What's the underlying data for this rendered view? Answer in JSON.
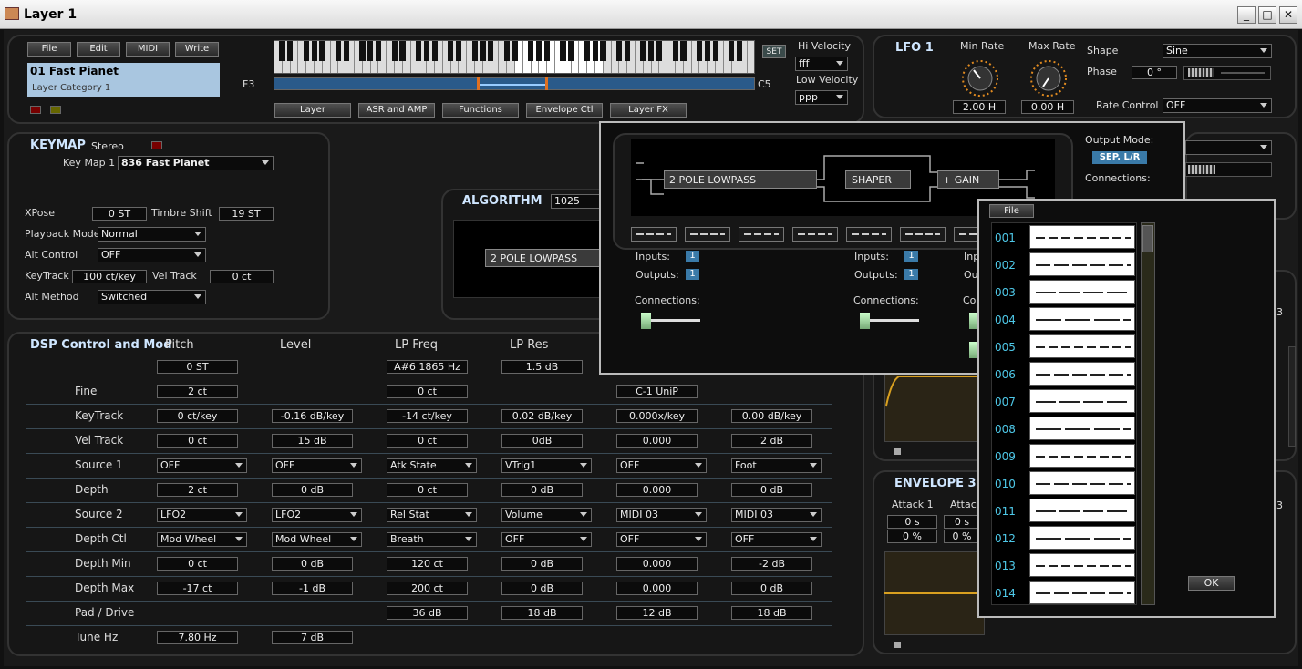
{
  "window": {
    "title": "Layer 1"
  },
  "top": {
    "menu": [
      "File",
      "Edit",
      "MIDI",
      "Write"
    ],
    "program": {
      "name": "01   Fast Pianet",
      "category": "Layer Category 1"
    },
    "keyboard": {
      "low": "F3",
      "high": "C5",
      "set": "SET"
    },
    "hi_velocity": {
      "label": "Hi Velocity",
      "value": "fff"
    },
    "low_velocity": {
      "label": "Low Velocity",
      "value": "ppp"
    },
    "tabs": [
      "Layer",
      "ASR and AMP",
      "Functions",
      "Envelope Ctl",
      "Layer FX"
    ]
  },
  "lfo": {
    "title": "LFO 1",
    "min_rate_label": "Min Rate",
    "min_rate": "2.00 H",
    "max_rate_label": "Max Rate",
    "max_rate": "0.00 H",
    "shape_label": "Shape",
    "shape": "Sine",
    "phase_label": "Phase",
    "phase": "0 °",
    "rate_control_label": "Rate Control",
    "rate_control": "OFF"
  },
  "keymap": {
    "title": "KEYMAP",
    "stereo_label": "Stereo",
    "keymap1_label": "Key Map 1",
    "keymap1": "836 Fast Pianet",
    "xpose_label": "XPose",
    "xpose": "0 ST",
    "timbre_label": "Timbre Shift",
    "timbre": "19 ST",
    "playback_label": "Playback Mode",
    "playback": "Normal",
    "altctl_label": "Alt Control",
    "altctl": "OFF",
    "keytrack_label": "KeyTrack",
    "keytrack": "100 ct/key",
    "veltrack_label": "Vel Track",
    "veltrack": "0 ct",
    "altmethod_label": "Alt Method",
    "altmethod": "Switched"
  },
  "algorithm": {
    "title": "ALGORITHM",
    "number": "1025",
    "block1": "2 POLE LOWPASS"
  },
  "dsp": {
    "title": "DSP Control and Mod",
    "columns": [
      "Pitch",
      "Level",
      "LP Freq",
      "LP Res"
    ],
    "top_values": [
      "0 ST",
      "",
      "A#6 1865 Hz",
      "1.5 dB"
    ],
    "rows": [
      {
        "label": "Fine",
        "cells": [
          "2 ct",
          "",
          "0 ct",
          "",
          "C-1 UniP",
          ""
        ]
      },
      {
        "label": "KeyTrack",
        "cells": [
          "0 ct/key",
          "-0.16 dB/key",
          "-14 ct/key",
          "0.02 dB/key",
          "0.000x/key",
          "0.00 dB/key"
        ]
      },
      {
        "label": "Vel Track",
        "cells": [
          "0 ct",
          "15 dB",
          "0 ct",
          "0dB",
          "0.000",
          "2 dB"
        ]
      },
      {
        "label": "Source 1",
        "cells": [
          "OFF",
          "OFF",
          "Atk State",
          "VTrig1",
          "OFF",
          "Foot"
        ],
        "dd": true
      },
      {
        "label": "Depth",
        "cells": [
          "2 ct",
          "0 dB",
          "0 ct",
          "0 dB",
          "0.000",
          "0 dB"
        ]
      },
      {
        "label": "Source 2",
        "cells": [
          "LFO2",
          "LFO2",
          "Rel Stat",
          "Volume",
          "MIDI 03",
          "MIDI 03"
        ],
        "dd": true
      },
      {
        "label": "Depth Ctl",
        "cells": [
          "Mod Wheel",
          "Mod Wheel",
          "Breath",
          "OFF",
          "OFF",
          "OFF"
        ],
        "dd": true
      },
      {
        "label": "Depth Min",
        "cells": [
          "0 ct",
          "0 dB",
          "120 ct",
          "0 dB",
          "0.000",
          "-2 dB"
        ]
      },
      {
        "label": "Depth Max",
        "cells": [
          "-17 ct",
          "-1 dB",
          "200 ct",
          "0 dB",
          "0.000",
          "0 dB"
        ]
      },
      {
        "label": "Pad / Drive",
        "cells": [
          "",
          "",
          "36 dB",
          "18 dB",
          "12 dB",
          "18 dB"
        ]
      },
      {
        "label": "Tune Hz",
        "cells": [
          "7.80 Hz",
          "7 dB",
          "",
          "",
          "",
          ""
        ]
      }
    ]
  },
  "algo_popup": {
    "blocks": [
      "2 POLE LOWPASS",
      "SHAPER",
      "+ GAIN"
    ],
    "output_mode_label": "Output Mode:",
    "output_mode": "SEP. L/R",
    "connections_label": "Connections:",
    "inputs_label": "Inputs:",
    "outputs_label": "Outputs:",
    "io_value": "1",
    "inp_partial": "Inp",
    "ou_partial": "Ou",
    "con_partial": "Con"
  },
  "envelope": {
    "title": "ENVELOPE 3",
    "attack1_label": "Attack 1",
    "attack2_label": "Attack",
    "attack1": "0 s",
    "attack1_pct": "0 %",
    "attack2": "0 s",
    "attack2_pct": "0 %",
    "right_digit": "3"
  },
  "file_popup": {
    "file_button": "File",
    "items": [
      "001",
      "002",
      "003",
      "004",
      "005",
      "006",
      "007",
      "008",
      "009",
      "010",
      "011",
      "012",
      "013",
      "014"
    ],
    "ok": "OK"
  }
}
